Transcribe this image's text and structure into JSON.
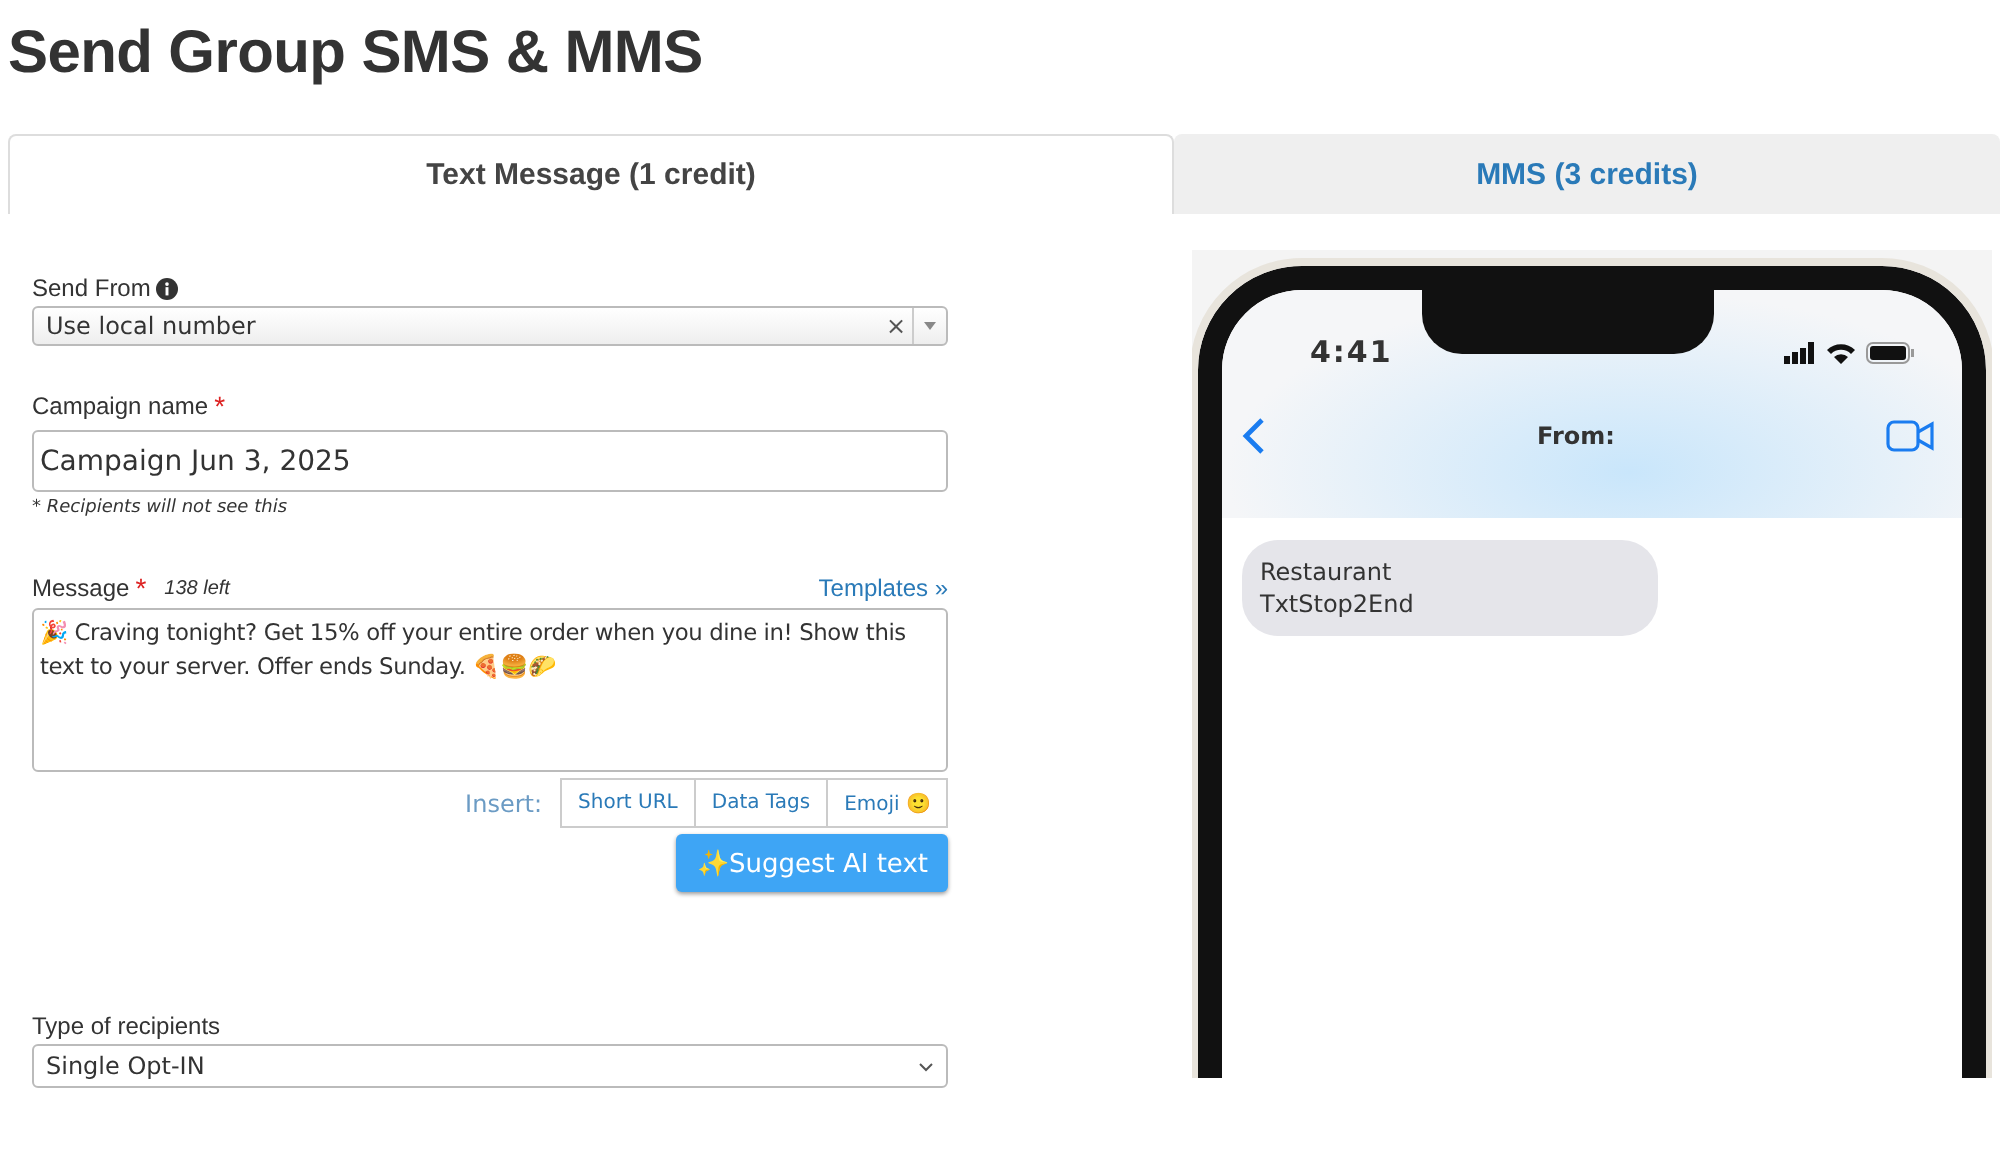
{
  "page_title": "Send Group SMS & MMS",
  "tabs": [
    {
      "label": "Text Message (1 credit)",
      "selected": true
    },
    {
      "label": "MMS (3 credits)",
      "selected": false
    }
  ],
  "form": {
    "send_from": {
      "label": "Send From",
      "value": "Use local number",
      "clear": "×"
    },
    "campaign_name": {
      "label": "Campaign name",
      "required_mark": "*",
      "value": "Campaign Jun 3, 2025",
      "note": "* Recipients will not see this"
    },
    "message": {
      "label": "Message",
      "required_mark": "*",
      "counter": "138 left",
      "templates_link": "Templates »",
      "value": "🎉 Craving tonight? Get 15% off your entire order when you dine in! Show this text to your server. Offer ends Sunday. 🍕🍔🌮"
    },
    "insert_label": "Insert:",
    "insert_buttons": [
      "Short URL",
      "Data Tags",
      "Emoji 🙂"
    ],
    "suggest_button": "✨Suggest AI text",
    "recipients": {
      "label": "Type of recipients",
      "value": "Single Opt-IN"
    }
  },
  "preview": {
    "time": "4:41",
    "header": "From:",
    "bubble_lines": [
      "Restaurant",
      "TxtStop2End"
    ]
  }
}
